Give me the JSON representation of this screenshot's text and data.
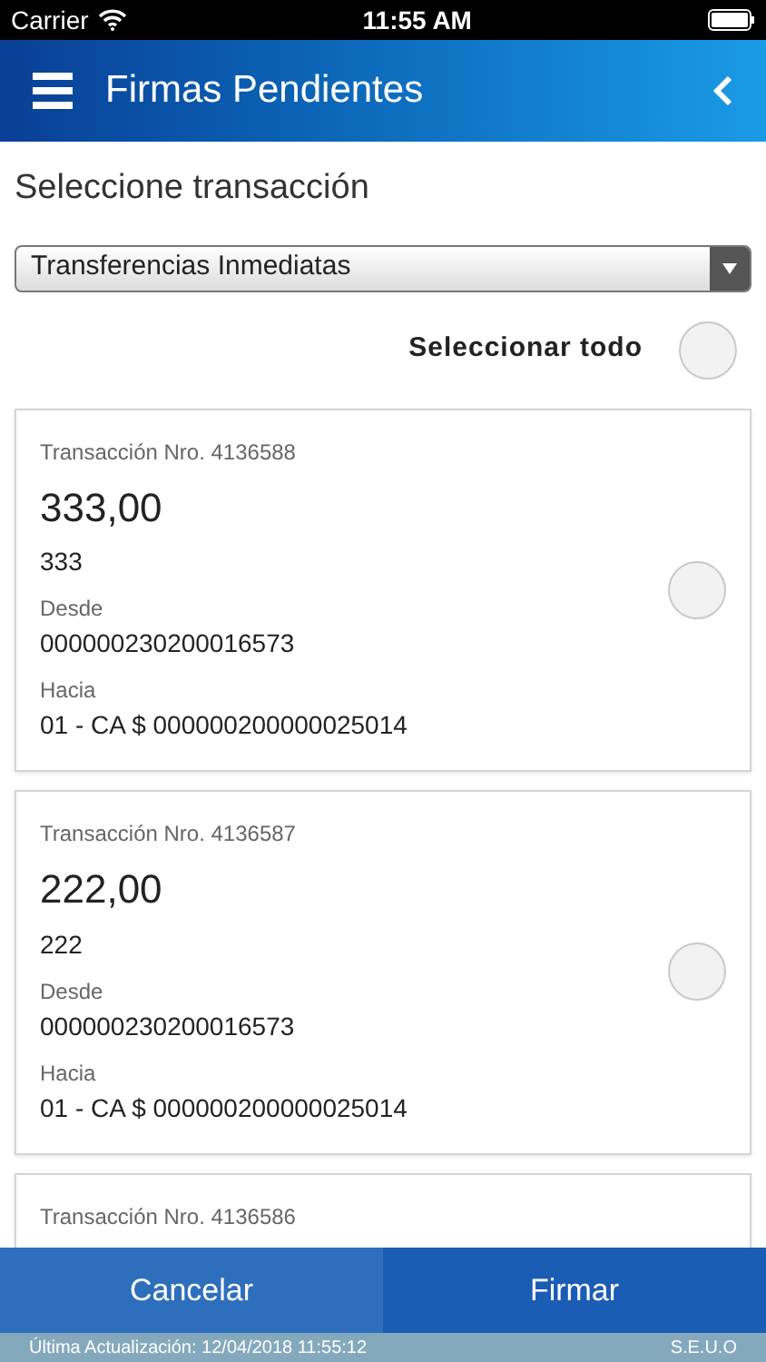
{
  "status_bar": {
    "carrier": "Carrier",
    "time": "11:55 AM"
  },
  "header": {
    "title": "Firmas Pendientes"
  },
  "section_title": "Seleccione transacción",
  "dropdown": {
    "value": "Transferencias Inmediatas"
  },
  "select_all": {
    "label": "Seleccionar todo",
    "selected": false
  },
  "transactions": [
    {
      "number": "Transacción Nro. 4136588",
      "amount": "333,00",
      "reference": "333",
      "from_label": "Desde",
      "from": "000000230200016573",
      "to_label": "Hacia",
      "to": "01 - CA $ 000000200000025014",
      "selected": false
    },
    {
      "number": "Transacción Nro. 4136587",
      "amount": "222,00",
      "reference": "222",
      "from_label": "Desde",
      "from": "000000230200016573",
      "to_label": "Hacia",
      "to": "01 - CA $ 000000200000025014",
      "selected": false
    },
    {
      "number": "Transacción Nro. 4136586"
    }
  ],
  "buttons": {
    "cancel": "Cancelar",
    "sign": "Firmar"
  },
  "footer": {
    "updated": "Última Actualización: 12/04/2018 11:55:12",
    "note": "S.E.U.O"
  }
}
